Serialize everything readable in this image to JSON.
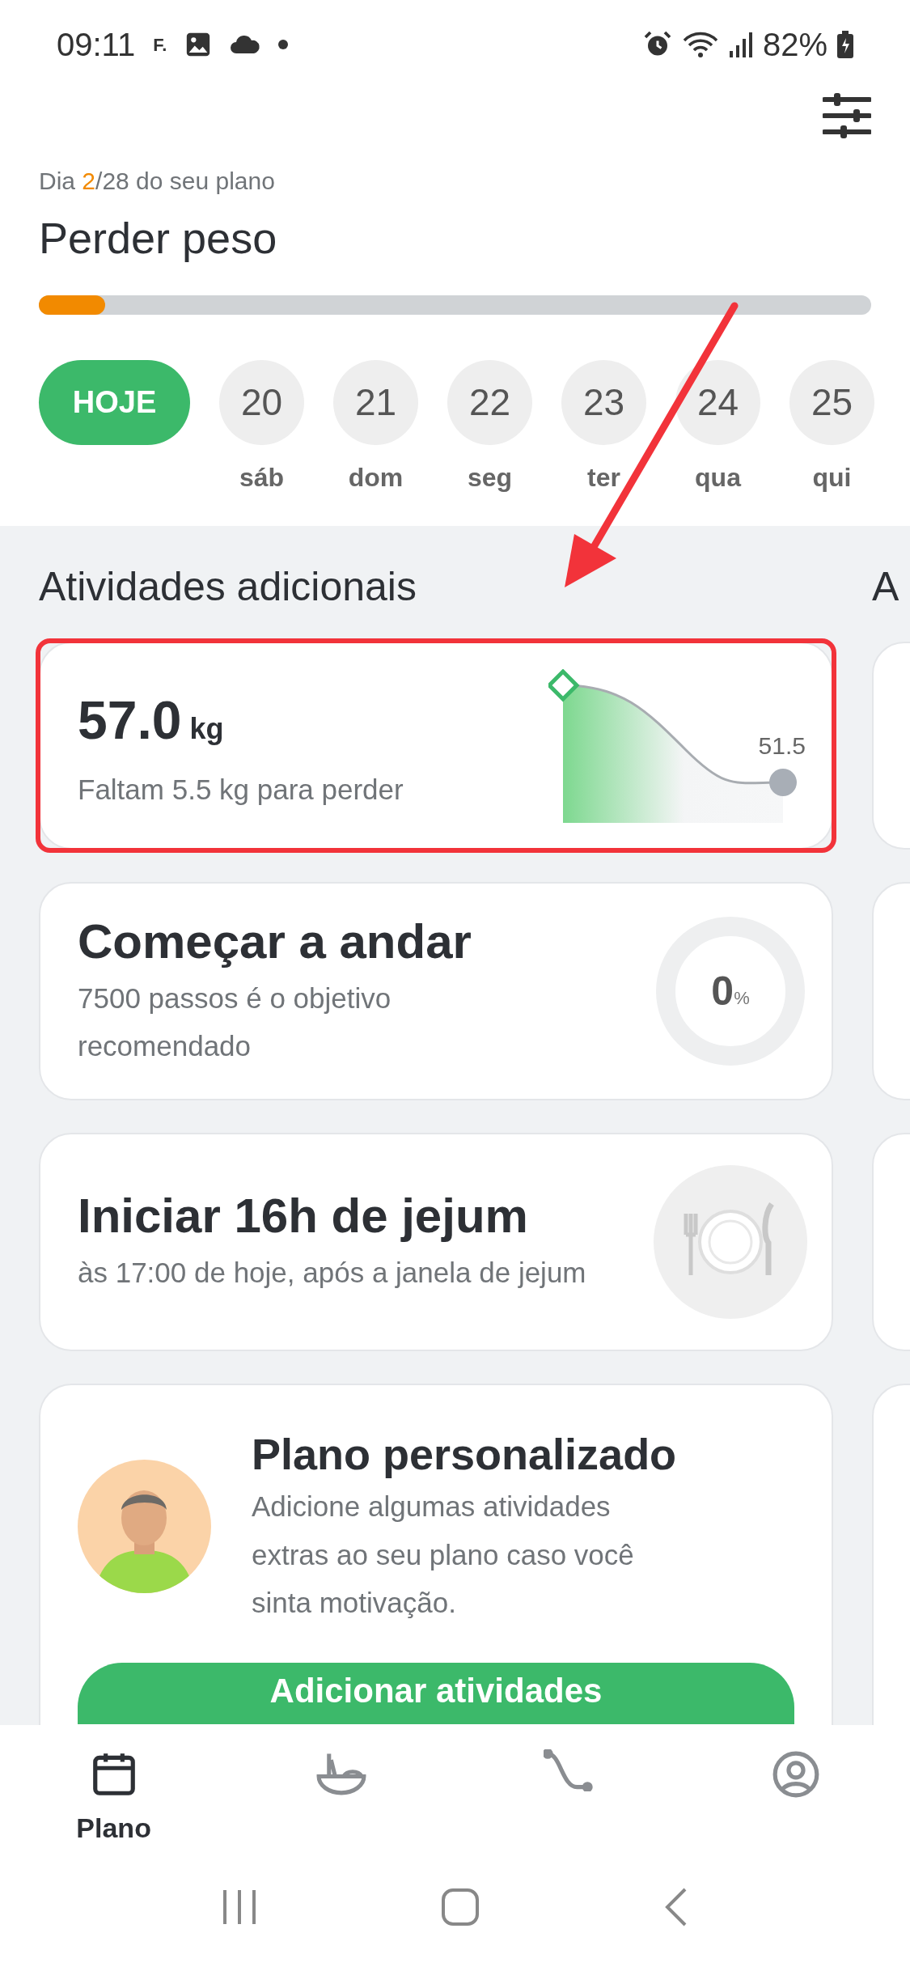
{
  "status_bar": {
    "time": "09:11",
    "notification_text": "F.",
    "battery": "82%"
  },
  "plan_header": {
    "day_prefix": "Dia ",
    "day_current": "2",
    "day_suffix": "/28 do seu plano",
    "title": "Perder peso",
    "level": 0.08
  },
  "days": [
    {
      "kind": "today",
      "label": "HOJE",
      "selected": true
    },
    {
      "kind": "day",
      "number": "20",
      "weekday": "sáb",
      "selected": false
    },
    {
      "kind": "day",
      "number": "21",
      "weekday": "dom",
      "selected": false
    },
    {
      "kind": "day",
      "number": "22",
      "weekday": "seg",
      "selected": false
    },
    {
      "kind": "day",
      "number": "23",
      "weekday": "ter",
      "selected": false
    },
    {
      "kind": "day",
      "number": "24",
      "weekday": "qua",
      "selected": false
    },
    {
      "kind": "day",
      "number": "25",
      "weekday": "qui",
      "selected": false
    }
  ],
  "section": {
    "title": "Atividades adicionais",
    "next_title": "A"
  },
  "cards": [
    {
      "kind": "weight",
      "value": "57.0",
      "unit": "kg",
      "subtitle": "Faltam 5.5 kg para perder",
      "target": "51.5",
      "highlighted": true
    },
    {
      "kind": "steps",
      "title": "Começar a andar",
      "subtitle": "7500 passos é o objetivo recomendado",
      "percent": "0",
      "percent_unit": "%",
      "level": 0
    },
    {
      "kind": "fasting",
      "title": "Iniciar 16h de jejum",
      "subtitle": "às 17:00 de hoje, após a janela de jejum"
    },
    {
      "kind": "plan",
      "title": "Plano personalizado",
      "subtitle": "Adicione algumas atividades extras ao seu plano caso você sinta motivação.",
      "button": "Adicionar atividades"
    }
  ],
  "bottom_nav": [
    {
      "kind": "plan",
      "label": "Plano",
      "selected": true
    },
    {
      "kind": "meals",
      "selected": false
    },
    {
      "kind": "progress",
      "selected": false
    },
    {
      "kind": "profile",
      "selected": false
    }
  ]
}
